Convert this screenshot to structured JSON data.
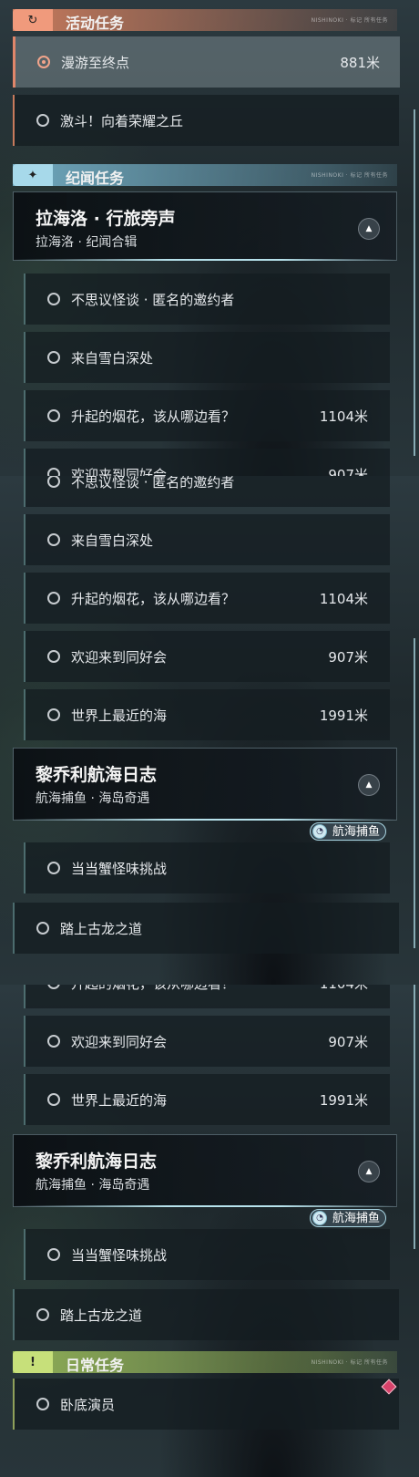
{
  "sections": {
    "activity": {
      "title": "活动任务",
      "icon": "circle-arrow-icon",
      "color": "#e0866a"
    },
    "chronicle": {
      "title": "纪闻任务",
      "icon": "sparkle-icon",
      "color": "#7fb9cf"
    },
    "daily": {
      "title": "日常任务",
      "icon": "alert-icon",
      "color": "#a9c46a"
    }
  },
  "header_deco": "NISHINOKI · 标记 所有任务",
  "activity_quests": [
    {
      "name": "漫游至终点",
      "distance": "881米",
      "selected": true
    },
    {
      "name": "激斗！向着荣耀之丘",
      "distance": ""
    }
  ],
  "card_lahailuo": {
    "title": "拉海洛 · 行旅旁声",
    "subtitle": "拉海洛 · 纪闻合辑"
  },
  "card_liqiaoli": {
    "title": "黎乔利航海日志",
    "subtitle": "航海捕鱼 · 海岛奇遇",
    "tag": "航海捕鱼"
  },
  "lahailuo_quests": [
    {
      "name": "不思议怪谈 · 匿名的邀约者",
      "distance": ""
    },
    {
      "name": "来自雪白深处",
      "distance": ""
    },
    {
      "name": "升起的烟花，该从哪边看？",
      "distance": "1104米"
    },
    {
      "name": "欢迎来到同好会",
      "distance": "907米"
    },
    {
      "name": "世界上最近的海",
      "distance": "1991米"
    }
  ],
  "liqiaoli_quests": [
    {
      "name": "当当蟹怪味挑战",
      "distance": ""
    }
  ],
  "road_quest": {
    "name": "踏上古龙之道",
    "distance": ""
  },
  "daily_quests": [
    {
      "name": "卧底演员",
      "distance": ""
    }
  ],
  "colors": {
    "active_row": "#e0866a",
    "tag_border": "#a9d6e3",
    "marker": "#d6426a"
  }
}
